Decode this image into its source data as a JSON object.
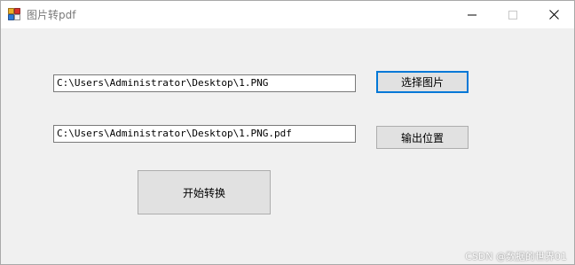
{
  "window": {
    "title": "图片转pdf",
    "icon": "app-icon",
    "controls": {
      "minimize_icon": "minimize-icon",
      "maximize_icon": "maximize-icon",
      "close_icon": "close-icon"
    }
  },
  "form": {
    "input_path": "C:\\Users\\Administrator\\Desktop\\1.PNG",
    "output_path": "C:\\Users\\Administrator\\Desktop\\1.PNG.pdf",
    "select_image_label": "选择图片",
    "output_location_label": "输出位置",
    "start_convert_label": "开始转换"
  },
  "watermark": "CSDN @数据的世界01",
  "colors": {
    "focus_border": "#0078d7",
    "button_bg": "#e1e1e1",
    "window_bg": "#f0f0f0"
  }
}
